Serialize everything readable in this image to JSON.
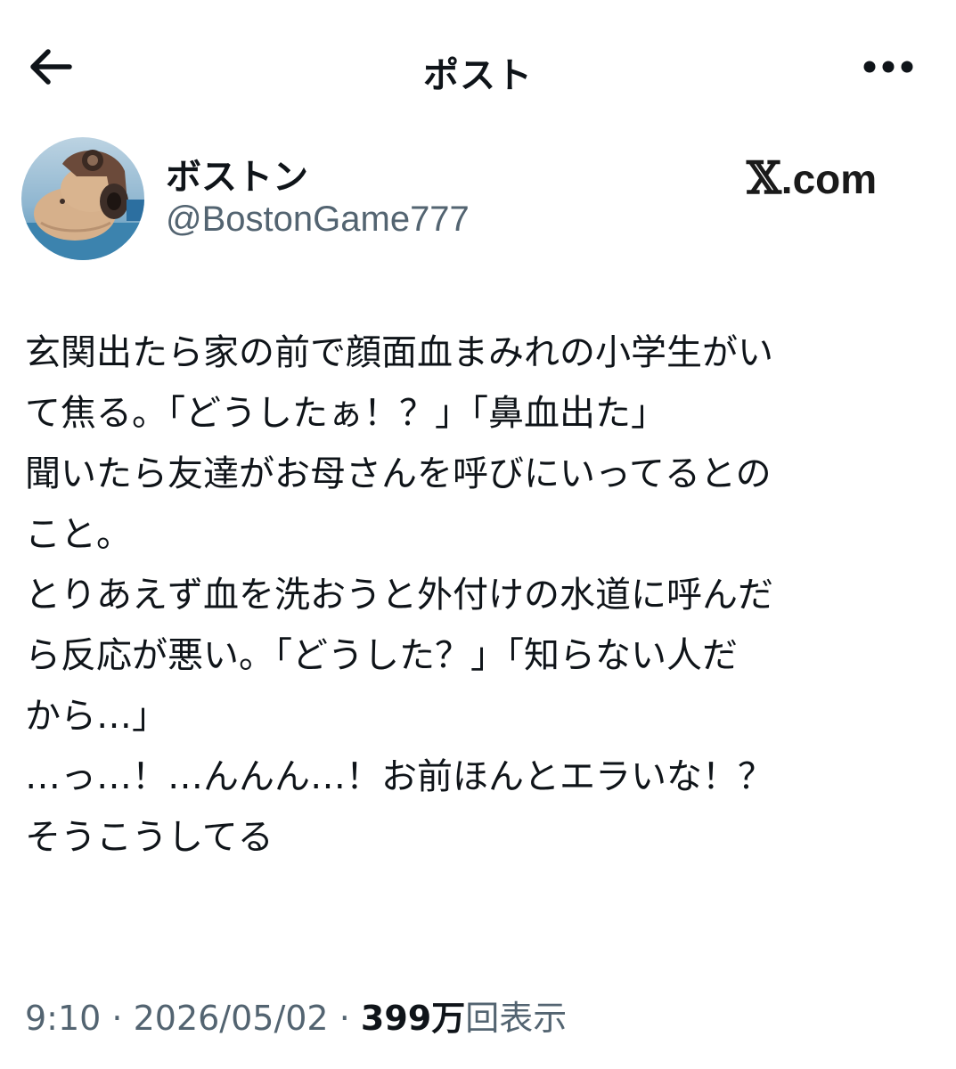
{
  "header": {
    "title": "ポスト",
    "back_icon": "arrow-left-icon",
    "more_icon": "more-horizontal-icon"
  },
  "author": {
    "display_name": "ボストン",
    "handle": "@BostonGame777",
    "avatar_icon": "avatar-image"
  },
  "watermark": {
    "x_glyph": "𝕏",
    "text": ".com"
  },
  "post": {
    "lines": [
      "玄関出たら家の前で顔面血まみれの小学生がい",
      "て焦る。「どうしたぁ！？」「鼻血出た」",
      "聞いたら友達がお母さんを呼びにいってるとの",
      "こと。",
      "とりあえず血を洗おうと外付けの水道に呼んだ",
      "ら反応が悪い。「どうした？」「知らない人だ",
      "から…」",
      "…っ…！…んんん…！お前ほんとエラいな！？",
      "そうこうしてる"
    ]
  },
  "meta": {
    "time": "9:10",
    "separator": " · ",
    "date": "2026/05/02",
    "views_count": "399",
    "views_unit": "万",
    "views_label": "回表示"
  },
  "colors": {
    "text_primary": "#0f1419",
    "text_secondary": "#536471",
    "background": "#ffffff"
  }
}
